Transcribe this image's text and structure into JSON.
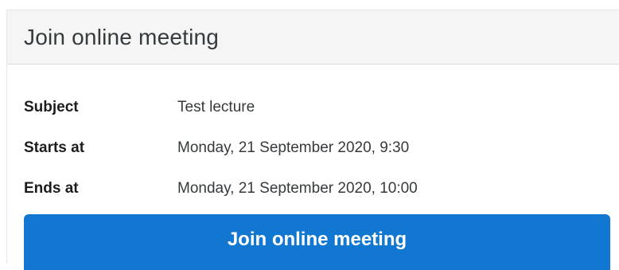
{
  "card": {
    "title": "Join online meeting"
  },
  "details": [
    {
      "label": "Subject",
      "value": "Test lecture"
    },
    {
      "label": "Starts at",
      "value": "Monday, 21 September 2020, 9:30"
    },
    {
      "label": "Ends at",
      "value": "Monday, 21 September 2020, 10:00"
    }
  ],
  "actions": {
    "join_label": "Join online meeting"
  },
  "colors": {
    "primary": "#1177d1",
    "header_bg": "#f5f5f5"
  }
}
